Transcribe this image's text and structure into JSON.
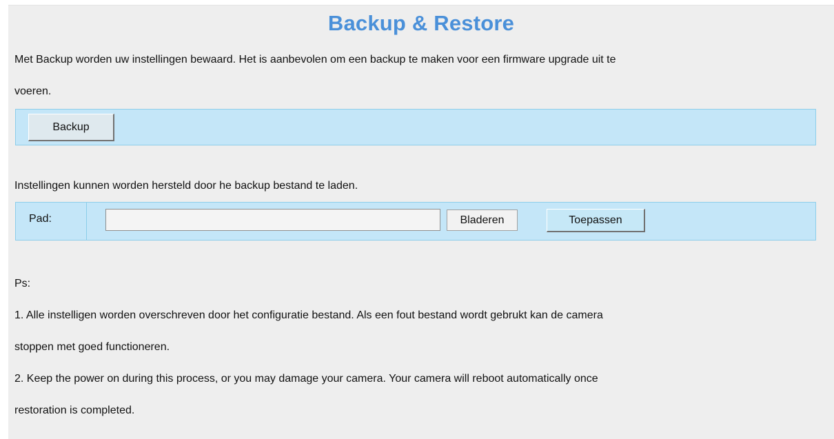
{
  "title": "Backup & Restore",
  "backup": {
    "description_line1": "Met Backup worden uw instellingen bewaard. Het is aanbevolen om een backup te maken voor een firmware upgrade uit te",
    "description_line2": "voeren.",
    "button_label": "Backup"
  },
  "restore": {
    "description": "Instellingen kunnen worden hersteld door he backup bestand te laden.",
    "path_label": "Pad:",
    "path_value": "",
    "browse_label": "Bladeren",
    "apply_label": "Toepassen"
  },
  "notes": {
    "heading": "Ps:",
    "note1_line1": "1. Alle instelligen worden overschreven door het configuratie bestand. Als een fout bestand wordt gebrukt kan de camera",
    "note1_line2": "stoppen met goed functioneren.",
    "note2_line1": "2. Keep the power on during this process, or you may damage your camera. Your camera will reboot automatically once",
    "note2_line2": "restoration is completed."
  },
  "colors": {
    "title": "#4a90d9",
    "panel_background": "#eeeeee",
    "box_background": "#c4e6f8",
    "box_border": "#8ccdea"
  }
}
